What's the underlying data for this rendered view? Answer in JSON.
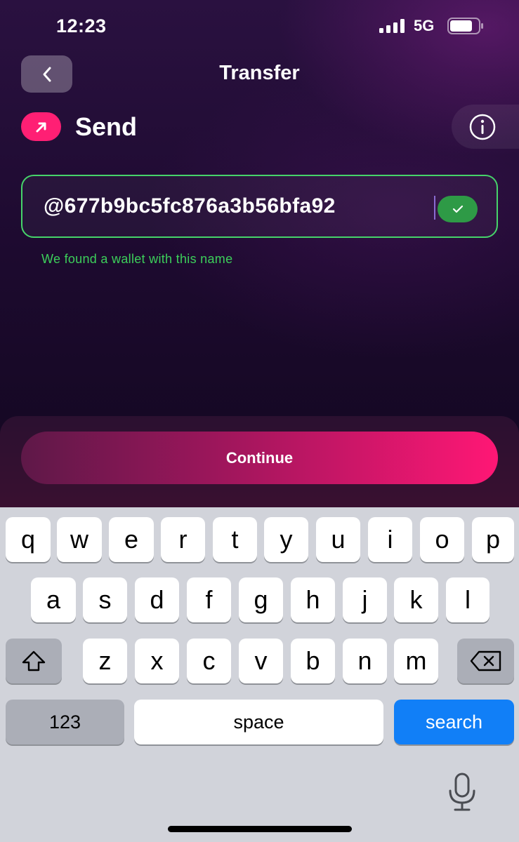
{
  "status_bar": {
    "time": "12:23",
    "network": "5G"
  },
  "header": {
    "title": "Transfer",
    "back_icon": "chevron-left-icon"
  },
  "send_section": {
    "label": "Send",
    "icon": "arrow-up-right-icon",
    "info_icon": "info-icon"
  },
  "recipient_input": {
    "value": "@677b9bc5fc876a3b56bfa92",
    "validation_message": "We found a wallet with this name",
    "valid_icon": "checkmark-icon"
  },
  "actions": {
    "continue_label": "Continue"
  },
  "keyboard": {
    "row1": [
      "q",
      "w",
      "e",
      "r",
      "t",
      "y",
      "u",
      "i",
      "o",
      "p"
    ],
    "row2": [
      "a",
      "s",
      "d",
      "f",
      "g",
      "h",
      "j",
      "k",
      "l"
    ],
    "row3": [
      "z",
      "x",
      "c",
      "v",
      "b",
      "n",
      "m"
    ],
    "numbers_label": "123",
    "space_label": "space",
    "search_label": "search",
    "shift_icon": "shift-icon",
    "delete_icon": "backspace-icon",
    "mic_icon": "microphone-icon"
  },
  "colors": {
    "accent_pink": "#ff1f74",
    "valid_green": "#46d46a",
    "keyboard_blue": "#117ff7"
  }
}
